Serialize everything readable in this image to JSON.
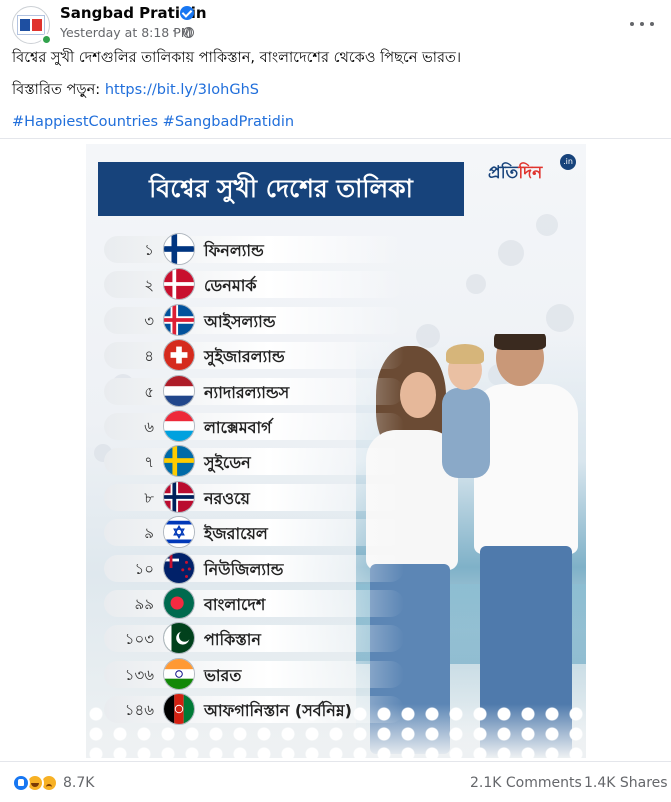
{
  "post": {
    "page_name": "Sangbad Pratidin",
    "timestamp": "Yesterday at 8:18 PM",
    "separator": "·",
    "text_line1": "বিশ্বের সুখী দেশগুলির তালিকায় পাকিস্তান, বাংলাদেশের থেকেও পিছনে ভারত।",
    "read_more_label": "বিস্তারিত পড়ুন:",
    "read_more_link": "https://bit.ly/3IohGhS",
    "hashtags": "#HappiestCountries #SangbadPratidin"
  },
  "graphic": {
    "title": "বিশ্বের সুখী দেশের তালিকা",
    "brand": {
      "part1": "প্রতি",
      "part2": "দিন",
      "suffix": ".in"
    },
    "rankings": [
      {
        "rank": "১",
        "country": "ফিনল্যান্ড",
        "flag": "finland"
      },
      {
        "rank": "২",
        "country": "ডেনমার্ক",
        "flag": "denmark"
      },
      {
        "rank": "৩",
        "country": "আইসল্যান্ড",
        "flag": "iceland"
      },
      {
        "rank": "৪",
        "country": "সুইজারল্যান্ড",
        "flag": "switzerland"
      },
      {
        "rank": "৫",
        "country": "ন্যাদারল্যান্ডস",
        "flag": "netherlands"
      },
      {
        "rank": "৬",
        "country": "লাক্সেমবার্গ",
        "flag": "luxembourg"
      },
      {
        "rank": "৭",
        "country": "সুইডেন",
        "flag": "sweden"
      },
      {
        "rank": "৮",
        "country": "নরওয়ে",
        "flag": "norway"
      },
      {
        "rank": "৯",
        "country": "ইজরায়েল",
        "flag": "israel"
      },
      {
        "rank": "১০",
        "country": "নিউজিল্যান্ড",
        "flag": "new-zealand"
      },
      {
        "rank": "৯৯",
        "country": "বাংলাদেশ",
        "flag": "bangladesh"
      },
      {
        "rank": "১০৩",
        "country": "পাকিস্তান",
        "flag": "pakistan"
      },
      {
        "rank": "১৩৬",
        "country": "ভারত",
        "flag": "india"
      },
      {
        "rank": "১৪৬",
        "country": "আফগানিস্তান (সর্বনিম্ন)",
        "flag": "afghanistan"
      }
    ]
  },
  "footer": {
    "reaction_icons": [
      "like-icon",
      "haha-icon",
      "sad-icon"
    ],
    "reaction_count": "8.7K",
    "comments": "2.1K Comments",
    "shares": "1.4K Shares"
  },
  "colors": {
    "banner": "#17437b",
    "link": "#216fdb",
    "secondary_text": "#65676b",
    "verified": "#1877f2"
  }
}
